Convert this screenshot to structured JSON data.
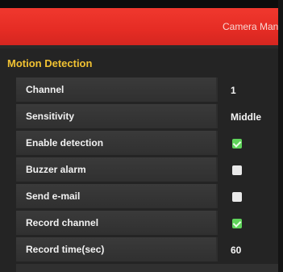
{
  "header": {
    "title": "Camera Man"
  },
  "section": {
    "title": "Motion Detection"
  },
  "settings": [
    {
      "label": "Channel",
      "type": "text",
      "value": "1"
    },
    {
      "label": "Sensitivity",
      "type": "text",
      "value": "Middle"
    },
    {
      "label": "Enable detection",
      "type": "checkbox",
      "checked": true
    },
    {
      "label": "Buzzer alarm",
      "type": "checkbox",
      "checked": false
    },
    {
      "label": "Send e-mail",
      "type": "checkbox",
      "checked": false
    },
    {
      "label": "Record channel",
      "type": "checkbox",
      "checked": true
    },
    {
      "label": "Record time(sec)",
      "type": "text",
      "value": "60"
    }
  ],
  "colors": {
    "header_red": "#e52c24",
    "section_title": "#f1c232",
    "checkbox_on": "#5fd35a",
    "checkbox_off": "#e9e9e9"
  }
}
